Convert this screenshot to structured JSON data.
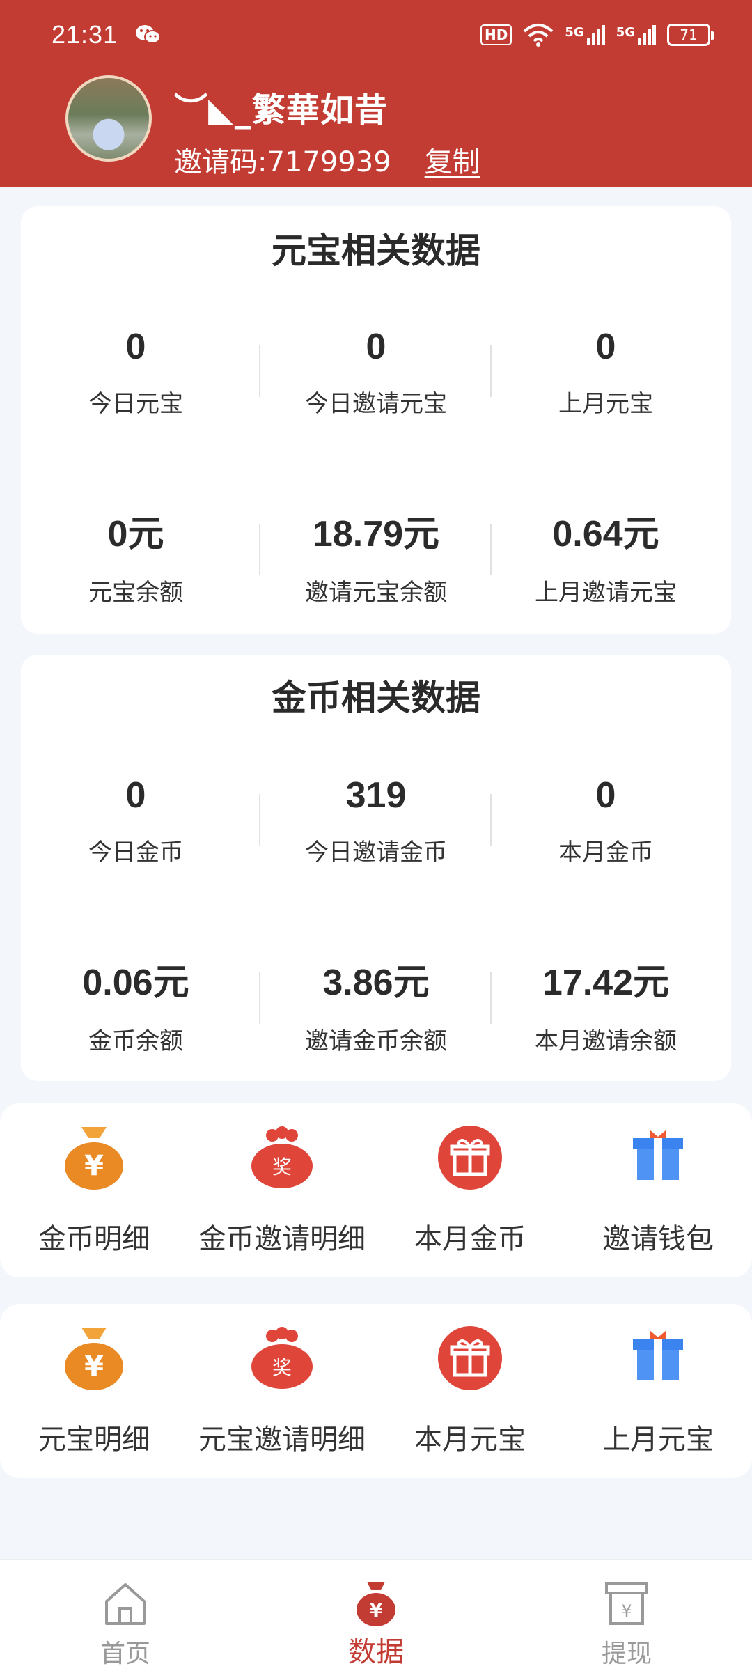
{
  "status_bar": {
    "time": "21:31",
    "battery": "71",
    "network1": "5G",
    "network2": "5G",
    "hd": "HD"
  },
  "profile": {
    "username": "︶◣_繁華如昔",
    "invite_code_label": "邀请码:7179939",
    "copy_label": "复制"
  },
  "yuanbao_card": {
    "title": "元宝相关数据",
    "stats": [
      {
        "value": "0",
        "label": "今日元宝"
      },
      {
        "value": "0",
        "label": "今日邀请元宝"
      },
      {
        "value": "0",
        "label": "上月元宝"
      },
      {
        "value": "0元",
        "label": "元宝余额"
      },
      {
        "value": "18.79元",
        "label": "邀请元宝余额"
      },
      {
        "value": "0.64元",
        "label": "上月邀请元宝"
      }
    ]
  },
  "coin_card": {
    "title": "金币相关数据",
    "stats": [
      {
        "value": "0",
        "label": "今日金币"
      },
      {
        "value": "319",
        "label": "今日邀请金币"
      },
      {
        "value": "0",
        "label": "本月金币"
      },
      {
        "value": "0.06元",
        "label": "金币余额"
      },
      {
        "value": "3.86元",
        "label": "邀请金币余额"
      },
      {
        "value": "17.42元",
        "label": "本月邀请余额"
      }
    ]
  },
  "menu_row_1": [
    {
      "label": "金币明细",
      "icon": "money-bag-icon"
    },
    {
      "label": "金币邀请明细",
      "icon": "reward-bag-icon"
    },
    {
      "label": "本月金币",
      "icon": "gift-circle-icon"
    },
    {
      "label": "邀请钱包",
      "icon": "gift-box-icon"
    }
  ],
  "menu_row_2": [
    {
      "label": "元宝明细",
      "icon": "money-bag-icon"
    },
    {
      "label": "元宝邀请明细",
      "icon": "reward-bag-icon"
    },
    {
      "label": "本月元宝",
      "icon": "gift-circle-icon"
    },
    {
      "label": "上月元宝",
      "icon": "gift-box-icon"
    }
  ],
  "bottom_nav": [
    {
      "label": "首页",
      "icon": "home-icon"
    },
    {
      "label": "数据",
      "icon": "data-money-bag-icon"
    },
    {
      "label": "提现",
      "icon": "withdraw-icon"
    }
  ],
  "colors": {
    "brand": "#c33c33",
    "orange": "#ea8a25",
    "blue": "#3b84f0"
  },
  "icon_glyphs": {
    "yen": "¥",
    "reward": "奖"
  }
}
